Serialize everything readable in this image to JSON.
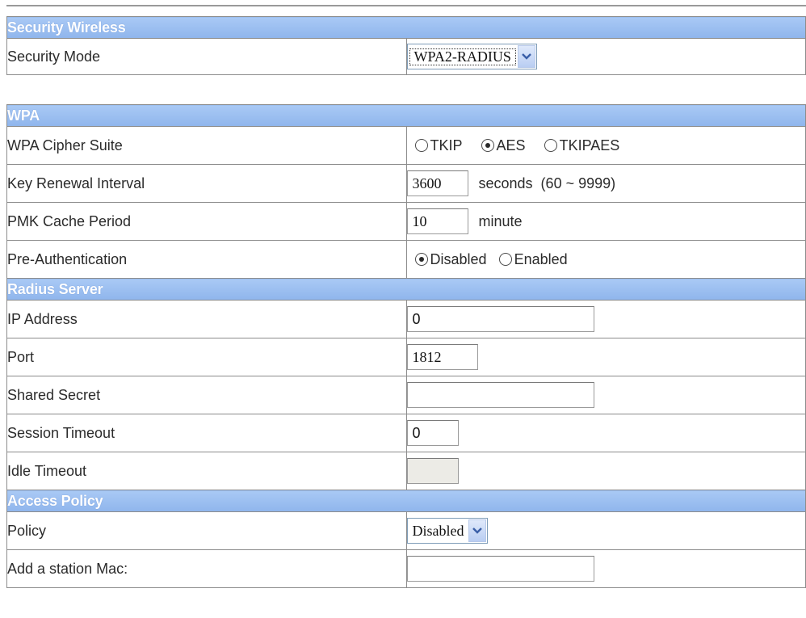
{
  "sections": {
    "security_wireless": "Security Wireless",
    "wpa": "WPA",
    "radius_server": "Radius Server",
    "access_policy": "Access Policy"
  },
  "security_mode": {
    "label": "Security Mode",
    "selected": "WPA2-RADIUS"
  },
  "cipher_suite": {
    "label": "WPA Cipher Suite",
    "options": [
      "TKIP",
      "AES",
      "TKIPAES"
    ],
    "selected": "AES"
  },
  "key_renewal": {
    "label": "Key Renewal Interval",
    "value": "3600",
    "unit": "seconds  (60 ~ 9999)"
  },
  "pmk_cache": {
    "label": "PMK Cache Period",
    "value": "10",
    "unit": "minute"
  },
  "pre_auth": {
    "label": "Pre-Authentication",
    "options": [
      "Disabled",
      "Enabled"
    ],
    "selected": "Disabled"
  },
  "radius": {
    "ip_label": "IP Address",
    "ip_value": "0",
    "port_label": "Port",
    "port_value": "1812",
    "secret_label": "Shared Secret",
    "secret_value": "",
    "session_label": "Session Timeout",
    "session_value": "0",
    "idle_label": "Idle Timeout",
    "idle_value": ""
  },
  "policy": {
    "label": "Policy",
    "selected": "Disabled"
  },
  "station_mac": {
    "label": "Add a station Mac:",
    "value": ""
  },
  "colors": {
    "header_bg": "#9bbff0",
    "header_text": "#ffffff",
    "border": "#8c8c8c"
  },
  "icons": {
    "dropdown": "chevron-down-icon",
    "radio": "radio-button-icon"
  }
}
